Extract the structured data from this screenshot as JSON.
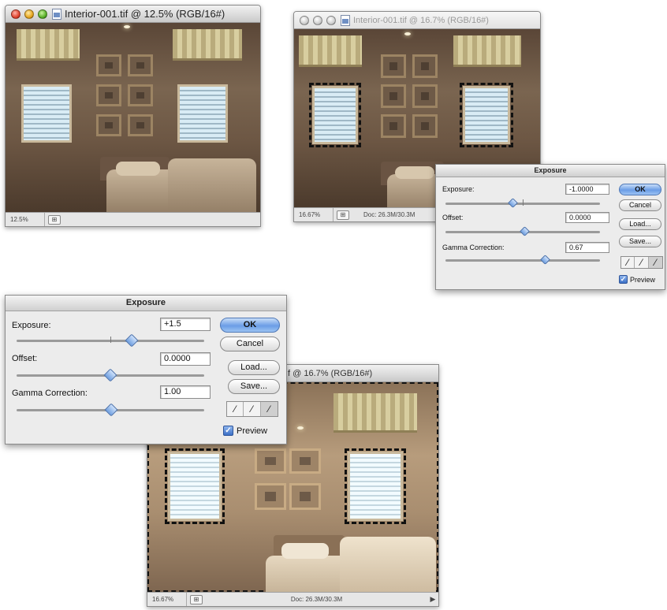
{
  "window_small": {
    "title": "Interior-001.tif @ 12.5% (RGB/16#)",
    "zoom": "12.5%"
  },
  "window_mid": {
    "title": "Interior-001.tif @ 16.7% (RGB/16#)",
    "zoom": "16.67%",
    "docinfo": "Doc: 26.3M/30.3M"
  },
  "window_large": {
    "title": "f @ 16.7% (RGB/16#)",
    "zoom": "16.67%",
    "docinfo": "Doc: 26.3M/30.3M"
  },
  "dialog_right": {
    "title": "Exposure",
    "exposure_label": "Exposure:",
    "exposure_value": "-1.0000",
    "offset_label": "Offset:",
    "offset_value": "0.0000",
    "gamma_label": "Gamma Correction:",
    "gamma_value": "0.67",
    "ok": "OK",
    "cancel": "Cancel",
    "load": "Load...",
    "save": "Save...",
    "preview_label": "Preview"
  },
  "dialog_left": {
    "title": "Exposure",
    "exposure_label": "Exposure:",
    "exposure_value": "+1.5",
    "offset_label": "Offset:",
    "offset_value": "0.0000",
    "gamma_label": "Gamma Correction:",
    "gamma_value": "1.00",
    "ok": "OK",
    "cancel": "Cancel",
    "load": "Load...",
    "save": "Save...",
    "preview_label": "Preview"
  },
  "icons": {
    "eyedropper_black": "eyedropper-black-icon",
    "eyedropper_gray": "eyedropper-gray-icon",
    "eyedropper_white": "eyedropper-white-icon",
    "preview_checked": true
  },
  "colors": {
    "ok_button": "#6b9de6",
    "selection": "#111111"
  }
}
